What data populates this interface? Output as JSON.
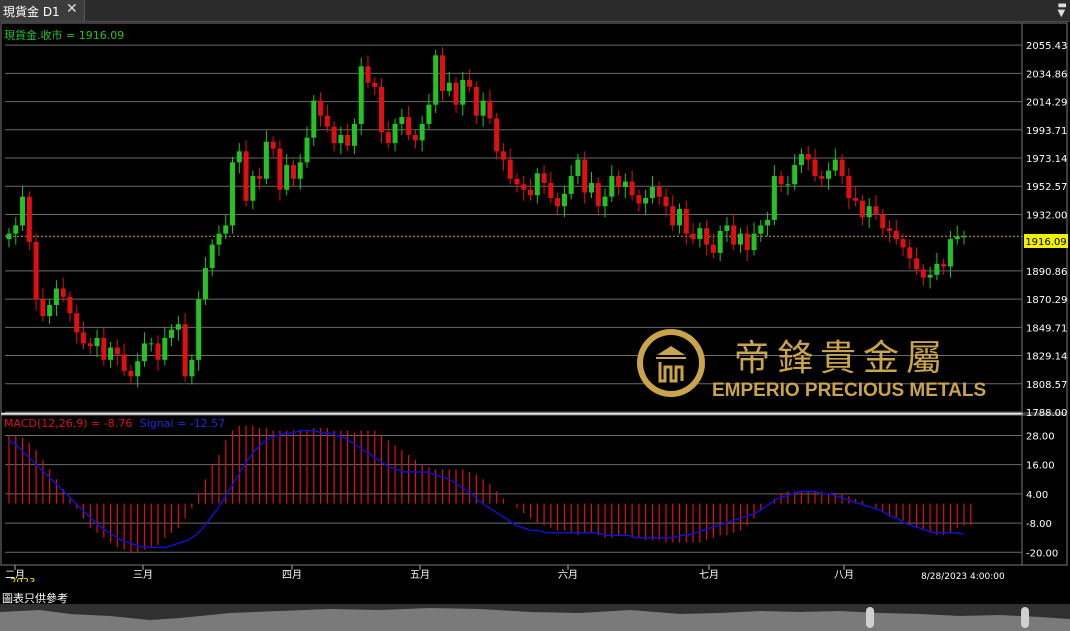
{
  "tab": {
    "title": "現貨金 D1"
  },
  "price_legend": {
    "label": "現貨金.收市 = 1916.09"
  },
  "macd_legend": {
    "macd": "MACD(12,26,9) = -8.76",
    "signal": "Signal = -12.57"
  },
  "last_price_tag": "1916.09",
  "date_label": "8/28/2023 4:00:00",
  "year_label": "2023",
  "footnote": "圖表只供參考",
  "logo": {
    "chinese": "帝鋒貴金屬",
    "english": "EMPERIO PRECIOUS METALS"
  },
  "colors": {
    "up": "#22c322",
    "down": "#e01010",
    "signal": "#1010d0",
    "histogram": "#e01010",
    "legend_green": "#22c322",
    "price_line": "#e0a020",
    "logo_gold": "#c9a44a"
  },
  "chart_data": [
    {
      "type": "candlestick",
      "title": "現貨金 D1",
      "ylim": [
        1788.0,
        2065.0
      ],
      "y_ticks": [
        "2055.43",
        "2034.86",
        "2014.29",
        "1993.71",
        "1973.14",
        "1952.57",
        "1932.00",
        "1890.86",
        "1870.29",
        "1849.71",
        "1829.14",
        "1808.57",
        "1788.00"
      ],
      "x_ticks": [
        "二月",
        "三月",
        "四月",
        "五月",
        "六月",
        "七月",
        "八月"
      ],
      "last_close": 1916.09,
      "close": [
        1918,
        1924,
        1945,
        1912,
        1870,
        1858,
        1866,
        1878,
        1872,
        1860,
        1846,
        1838,
        1836,
        1842,
        1826,
        1835,
        1830,
        1818,
        1814,
        1825,
        1838,
        1838,
        1826,
        1842,
        1848,
        1852,
        1814,
        1826,
        1870,
        1893,
        1910,
        1918,
        1924,
        1970,
        1978,
        1942,
        1960,
        1958,
        1985,
        1980,
        1950,
        1968,
        1958,
        1970,
        1988,
        2015,
        2004,
        1996,
        1984,
        1990,
        1982,
        1998,
        2040,
        2028,
        2025,
        1992,
        1984,
        1998,
        2003,
        1990,
        1986,
        1998,
        2012,
        2048,
        2022,
        2028,
        2012,
        2030,
        2025,
        2004,
        2015,
        2002,
        1978,
        1972,
        1958,
        1954,
        1950,
        1946,
        1962,
        1955,
        1944,
        1938,
        1947,
        1960,
        1972,
        1948,
        1955,
        1938,
        1945,
        1960,
        1952,
        1956,
        1946,
        1940,
        1944,
        1952,
        1945,
        1938,
        1924,
        1936,
        1918,
        1914,
        1922,
        1910,
        1904,
        1920,
        1924,
        1910,
        1918,
        1906,
        1918,
        1924,
        1928,
        1960,
        1954,
        1954,
        1968,
        1976,
        1972,
        1960,
        1958,
        1964,
        1972,
        1960,
        1944,
        1942,
        1930,
        1938,
        1932,
        1922,
        1920,
        1914,
        1908,
        1900,
        1892,
        1886,
        1888,
        1896,
        1894,
        1914,
        1916,
        1916.09
      ]
    },
    {
      "type": "bar+line",
      "name": "MACD(12,26,9)",
      "ylim": [
        -24.0,
        36.0
      ],
      "y_ticks": [
        "28.00",
        "16.00",
        "4.00",
        "-8.00",
        "-20.00"
      ],
      "macd_last": -8.76,
      "signal_last": -12.57,
      "macd": [
        28,
        28,
        27,
        25,
        22,
        18,
        14,
        10,
        6,
        2,
        -2,
        -6,
        -10,
        -12,
        -14,
        -16,
        -18,
        -19,
        -20,
        -20,
        -19,
        -18,
        -17,
        -14,
        -12,
        -10,
        -6,
        -2,
        4,
        10,
        16,
        20,
        26,
        30,
        32,
        32,
        32,
        31,
        31,
        30,
        30,
        30,
        30,
        30,
        30,
        31,
        31,
        31,
        30,
        30,
        30,
        29,
        30,
        30,
        30,
        28,
        26,
        24,
        22,
        20,
        18,
        16,
        15,
        14,
        14,
        14,
        14,
        14,
        13,
        12,
        10,
        8,
        5,
        2,
        0,
        -2,
        -4,
        -6,
        -8,
        -9,
        -10,
        -11,
        -11,
        -12,
        -13,
        -12,
        -12,
        -13,
        -14,
        -14,
        -13,
        -13,
        -14,
        -14,
        -15,
        -15,
        -15,
        -16,
        -16,
        -16,
        -16,
        -16,
        -16,
        -15,
        -14,
        -13,
        -13,
        -12,
        -11,
        -9,
        -6,
        -3,
        0,
        2,
        4,
        5,
        5,
        5,
        5,
        5,
        5,
        4,
        4,
        4,
        3,
        2,
        1,
        0,
        -2,
        -3,
        -5,
        -6,
        -7,
        -9,
        -10,
        -11,
        -12,
        -13,
        -13,
        -12,
        -10,
        -9,
        -8.76
      ],
      "signal": [
        26,
        24,
        21,
        18,
        15,
        12,
        9,
        6,
        3,
        0,
        -3,
        -6,
        -9,
        -11,
        -13,
        -15,
        -16,
        -17,
        -18,
        -18,
        -18,
        -18,
        -17,
        -16,
        -15,
        -13,
        -10,
        -6,
        -2,
        3,
        8,
        13,
        18,
        22,
        25,
        27,
        28,
        29,
        29,
        30,
        30,
        30,
        29,
        29,
        28,
        27,
        25,
        23,
        21,
        19,
        17,
        15,
        14,
        13,
        13,
        13,
        13,
        12,
        11,
        10,
        8,
        6,
        4,
        1,
        -1,
        -3,
        -5,
        -7,
        -9,
        -10,
        -11,
        -11,
        -12,
        -12,
        -12,
        -12,
        -12,
        -12,
        -12,
        -12,
        -13,
        -13,
        -13,
        -13,
        -14,
        -14,
        -14,
        -14,
        -14,
        -14,
        -13,
        -13,
        -12,
        -11,
        -10,
        -9,
        -8,
        -7,
        -6,
        -5,
        -4,
        -2,
        0,
        2,
        3,
        4,
        5,
        5,
        5,
        4,
        4,
        3,
        2,
        1,
        0,
        -1,
        -2,
        -3,
        -5,
        -6,
        -8,
        -9,
        -10,
        -11,
        -12,
        -12,
        -12,
        -12,
        -12.57
      ]
    }
  ]
}
